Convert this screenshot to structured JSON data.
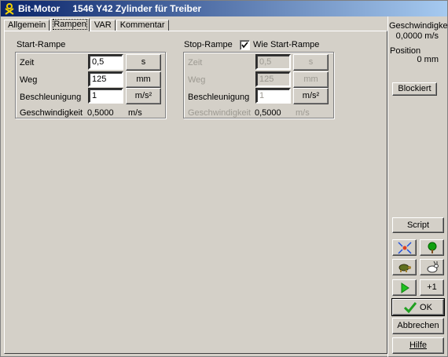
{
  "window": {
    "title": "Bit-Motor",
    "subtitle": "1546 Y42 Zylinder für Treiber"
  },
  "tabs": [
    {
      "label": "Allgemein",
      "active": false
    },
    {
      "label": "Rampen",
      "active": true
    },
    {
      "label": "VAR",
      "active": false
    },
    {
      "label": "Kommentar",
      "active": false
    }
  ],
  "start_ramp": {
    "title": "Start-Rampe",
    "zeit": {
      "label": "Zeit",
      "value": "0,5",
      "unit": "s"
    },
    "weg": {
      "label": "Weg",
      "value": "125",
      "unit": "mm"
    },
    "beschleunigung": {
      "label": "Beschleunigung",
      "value": "1",
      "unit": "m/s²"
    },
    "geschwindigkeit": {
      "label": "Geschwindigkeit",
      "value": "0,5000",
      "unit": "m/s"
    }
  },
  "stop_ramp": {
    "title": "Stop-Rampe",
    "same_as_start": {
      "label": "Wie Start-Rampe",
      "checked": true
    },
    "zeit": {
      "label": "Zeit",
      "value": "0,5",
      "unit": "s"
    },
    "weg": {
      "label": "Weg",
      "value": "125",
      "unit": "mm"
    },
    "beschleunigung": {
      "label": "Beschleunigung",
      "value": "1",
      "unit": "m/s²"
    },
    "geschwindigkeit": {
      "label": "Geschwindigkeit",
      "value": "0,5000",
      "unit": "m/s"
    }
  },
  "sidebar": {
    "speed_label": "Geschwindigkeit",
    "speed_value": "0,0000 m/s",
    "position_label": "Position",
    "position_value": "0 mm",
    "blocked_button": "Blockiert",
    "script_button": "Script",
    "plus_one_button": "+1",
    "ok_button": "OK",
    "cancel_button": "Abbrechen",
    "help_button": "Hilfe"
  },
  "colors": {
    "title_start": "#0a246a",
    "title_end": "#a6caf0",
    "face": "#d4d0c8",
    "ok_check": "#20a020",
    "play": "#20c020"
  }
}
